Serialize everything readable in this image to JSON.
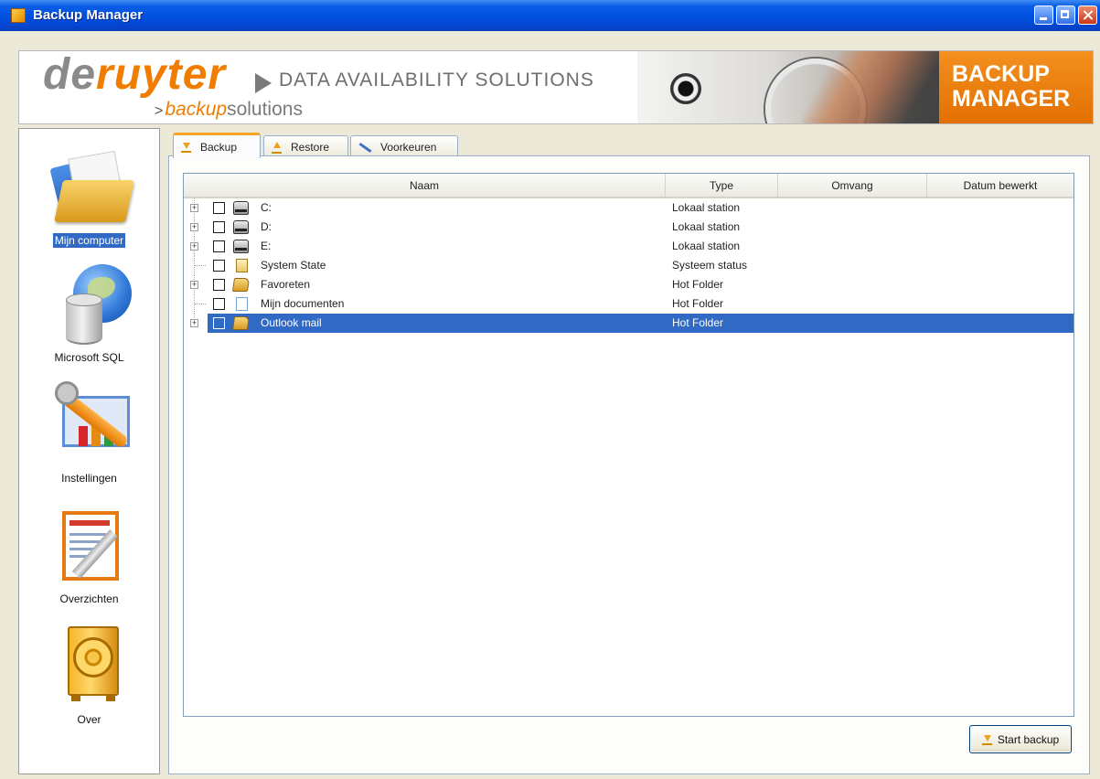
{
  "window": {
    "title": "Backup Manager"
  },
  "banner": {
    "brand_de": "de",
    "brand_ruyter": "ruyter",
    "tagline": "DATA AVAILABILITY SOLUTIONS",
    "sub_backup": "backup",
    "sub_solutions": "solutions",
    "product_line1": "BACKUP",
    "product_line2": "MANAGER"
  },
  "nav": {
    "items": [
      {
        "label": "Mijn computer",
        "icon": "folder-icon",
        "selected": true
      },
      {
        "label": "Microsoft SQL",
        "icon": "database-globe-icon",
        "selected": false
      },
      {
        "label": "Instellingen",
        "icon": "settings-tools-icon",
        "selected": false
      },
      {
        "label": "Overzichten",
        "icon": "report-icon",
        "selected": false
      },
      {
        "label": "Over",
        "icon": "safe-icon",
        "selected": false
      }
    ]
  },
  "tabs": [
    {
      "label": "Backup",
      "icon": "download-icon",
      "active": true
    },
    {
      "label": "Restore",
      "icon": "upload-icon",
      "active": false
    },
    {
      "label": "Voorkeuren",
      "icon": "brush-icon",
      "active": false
    }
  ],
  "list": {
    "columns": [
      "Naam",
      "Type",
      "Omvang",
      "Datum bewerkt"
    ],
    "rows": [
      {
        "name": "C:",
        "type": "Lokaal station",
        "icon": "drive-icon",
        "expandable": true,
        "checked": false,
        "selected": false
      },
      {
        "name": "D:",
        "type": "Lokaal station",
        "icon": "drive-icon",
        "expandable": true,
        "checked": false,
        "selected": false
      },
      {
        "name": "E:",
        "type": "Lokaal station",
        "icon": "drive-icon",
        "expandable": true,
        "checked": false,
        "selected": false
      },
      {
        "name": "System State",
        "type": "Systeem status",
        "icon": "system-state-icon",
        "expandable": false,
        "checked": false,
        "selected": false
      },
      {
        "name": "Favoreten",
        "type": "Hot Folder",
        "icon": "folder-icon",
        "expandable": true,
        "checked": false,
        "selected": false
      },
      {
        "name": "Mijn documenten",
        "type": "Hot Folder",
        "icon": "document-icon",
        "expandable": false,
        "checked": false,
        "selected": false
      },
      {
        "name": "Outlook mail",
        "type": "Hot Folder",
        "icon": "folder-icon",
        "expandable": true,
        "checked": false,
        "selected": true
      }
    ]
  },
  "actions": {
    "start_backup": "Start backup"
  },
  "colors": {
    "titlebar": "#0050e0",
    "accent_orange": "#f07d00",
    "selection": "#316ac5"
  }
}
